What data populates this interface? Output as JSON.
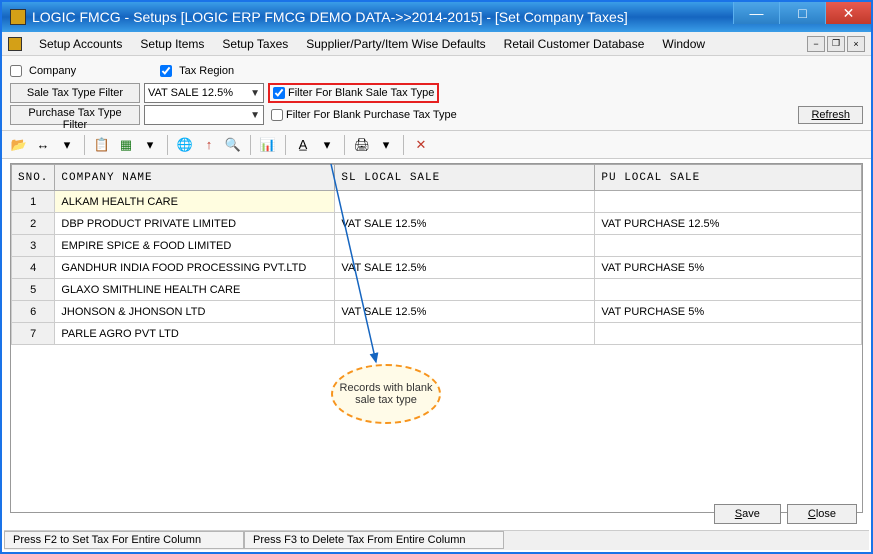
{
  "window": {
    "title": "LOGIC FMCG - Setups  [LOGIC ERP FMCG DEMO DATA->>2014-2015] - [Set Company Taxes]"
  },
  "menu": [
    "Setup Accounts",
    "Setup Items",
    "Setup Taxes",
    "Supplier/Party/Item Wise Defaults",
    "Retail Customer Database",
    "Window"
  ],
  "filters": {
    "company_label": "Company",
    "tax_region_label": "Tax Region",
    "sale_tax_filter_btn": "Sale Tax Type Filter",
    "sale_tax_value": "VAT SALE 12.5%",
    "purchase_tax_filter_btn": "Purchase Tax Type Filter",
    "purchase_tax_value": "",
    "filter_blank_sale": "Filter For Blank Sale Tax Type",
    "filter_blank_purchase": "Filter For Blank Purchase Tax Type",
    "refresh": "Refresh"
  },
  "columns": [
    "SNO.",
    "COMPANY NAME",
    "SL LOCAL SALE",
    "PU LOCAL SALE"
  ],
  "rows": [
    {
      "sno": "1",
      "name": "ALKAM HEALTH CARE",
      "sl": "",
      "pu": ""
    },
    {
      "sno": "2",
      "name": "DBP PRODUCT PRIVATE LIMITED",
      "sl": "VAT SALE 12.5%",
      "pu": "VAT PURCHASE 12.5%"
    },
    {
      "sno": "3",
      "name": "EMPIRE SPICE & FOOD LIMITED",
      "sl": "",
      "pu": ""
    },
    {
      "sno": "4",
      "name": "GANDHUR INDIA FOOD PROCESSING PVT.LTD",
      "sl": "VAT SALE 12.5%",
      "pu": "VAT PURCHASE 5%"
    },
    {
      "sno": "5",
      "name": "GLAXO SMITHLINE HEALTH CARE",
      "sl": "",
      "pu": ""
    },
    {
      "sno": "6",
      "name": "JHONSON & JHONSON LTD",
      "sl": "VAT SALE 12.5%",
      "pu": "VAT PURCHASE 5%"
    },
    {
      "sno": "7",
      "name": "PARLE AGRO PVT LTD",
      "sl": "",
      "pu": ""
    }
  ],
  "callout": "Records with blank sale tax type",
  "buttons": {
    "save": "Save",
    "close": "Close"
  },
  "status": {
    "f2": "Press F2 to Set Tax For Entire Column",
    "f3": "Press F3 to Delete Tax From Entire Column"
  }
}
